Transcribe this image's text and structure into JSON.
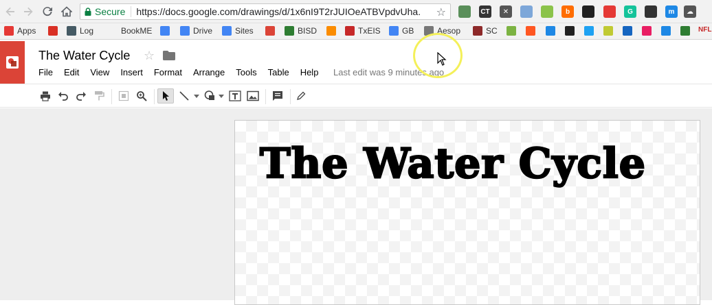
{
  "browser": {
    "secure_label": "Secure",
    "url": "https://docs.google.com/drawings/d/1x6nI9T2rJUIOeATBVpdvUha..."
  },
  "extensions": [
    {
      "name": "ext-1",
      "text": "",
      "color": "#5a8f5a"
    },
    {
      "name": "ext-ct",
      "text": "CT",
      "color": "#333333"
    },
    {
      "name": "ext-tools",
      "text": "✕",
      "color": "#555555"
    },
    {
      "name": "ext-4",
      "text": "",
      "color": "#7da7d9"
    },
    {
      "name": "ext-5",
      "text": "",
      "color": "#8bc34a"
    },
    {
      "name": "ext-b",
      "text": "b",
      "color": "#ff6d00"
    },
    {
      "name": "ext-7",
      "text": "",
      "color": "#212121"
    },
    {
      "name": "ext-8",
      "text": "",
      "color": "#e53935"
    },
    {
      "name": "ext-g",
      "text": "G",
      "color": "#15c39a"
    },
    {
      "name": "ext-10",
      "text": "",
      "color": "#333333"
    },
    {
      "name": "ext-m",
      "text": "m",
      "color": "#1e88e5"
    },
    {
      "name": "ext-cloud",
      "text": "☁",
      "color": "#555555"
    }
  ],
  "bookmarks": [
    {
      "label": "Apps",
      "icon": "apps-grid-icon",
      "color": "#e53935"
    },
    {
      "label": "",
      "icon": "gmail-icon",
      "color": "#d93025"
    },
    {
      "label": "Log",
      "icon": "log-icon",
      "color": "#455a64"
    },
    {
      "label": "BookME",
      "icon": "",
      "color": ""
    },
    {
      "label": "",
      "icon": "calendar-icon",
      "color": "#4285f4"
    },
    {
      "label": "Drive",
      "icon": "google-icon",
      "color": "#4285f4"
    },
    {
      "label": "Sites",
      "icon": "sites-icon",
      "color": "#4285f4"
    },
    {
      "label": "",
      "icon": "google-plus-icon",
      "color": "#db4437"
    },
    {
      "label": "BISD",
      "icon": "bisd-icon",
      "color": "#2e7d32"
    },
    {
      "label": "",
      "icon": "alert-icon",
      "color": "#fb8c00"
    },
    {
      "label": "TxEIS",
      "icon": "texas-icon",
      "color": "#c62828"
    },
    {
      "label": "GB",
      "icon": "google-icon",
      "color": "#4285f4"
    },
    {
      "label": "Aesop",
      "icon": "aesop-icon",
      "color": "#777777"
    },
    {
      "label": "SC",
      "icon": "sc-icon",
      "color": "#8d2929"
    },
    {
      "label": "",
      "icon": "m-icon",
      "color": "#7cb342"
    },
    {
      "label": "",
      "icon": "blogger-icon",
      "color": "#ff5722"
    },
    {
      "label": "",
      "icon": "window-icon",
      "color": "#1e88e5"
    },
    {
      "label": "",
      "icon": "paw-icon",
      "color": "#212121"
    },
    {
      "label": "",
      "icon": "twitter-icon",
      "color": "#1da1f2"
    },
    {
      "label": "",
      "icon": "cat-icon",
      "color": "#c0ca33"
    },
    {
      "label": "",
      "icon": "tv-icon",
      "color": "#1565c0"
    },
    {
      "label": "",
      "icon": "ob-icon",
      "color": "#e91e63"
    },
    {
      "label": "",
      "icon": "globe-icon",
      "color": "#1e88e5"
    },
    {
      "label": "",
      "icon": "person-icon",
      "color": "#2e7d32"
    },
    {
      "label": "NFL",
      "icon": "",
      "color": "#c62828"
    }
  ],
  "app": {
    "doc_title": "The Water Cycle",
    "menu": [
      "File",
      "Edit",
      "View",
      "Insert",
      "Format",
      "Arrange",
      "Tools",
      "Table",
      "Help"
    ],
    "last_edit": "Last edit was 9 minutes ago",
    "accent_color": "#db4437"
  },
  "toolbar": {
    "tools": [
      "print-icon",
      "undo-icon",
      "redo-icon",
      "paint-format-icon",
      "zoom-fit-icon",
      "zoom-icon",
      "select-icon",
      "line-icon",
      "shape-icon",
      "text-box-icon",
      "image-icon",
      "comment-icon",
      "pencil-icon"
    ]
  },
  "canvas": {
    "title_text": "The Water Cycle"
  }
}
